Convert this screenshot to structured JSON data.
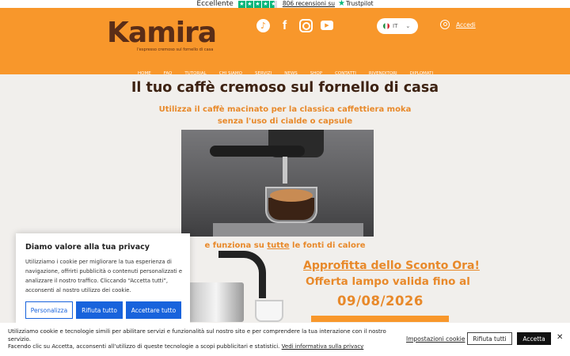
{
  "trustpilot": {
    "label": "Eccellente",
    "reviews": "806 recensioni su",
    "brand": "Trustpilot",
    "stars": 4.5
  },
  "brand": {
    "name": "Kamira",
    "tagline": "l'espresso cremoso sul fornello di casa",
    "primary_color": "#f8972b",
    "text_color": "#3d2212"
  },
  "social": [
    "tiktok-icon",
    "facebook-icon",
    "instagram-icon",
    "youtube-icon"
  ],
  "language": {
    "selected": "IT"
  },
  "login": {
    "label": "Accedi"
  },
  "nav": [
    "HOME",
    "FAQ",
    "TUTORIAL",
    "CHI SIAMO",
    "SERVIZI",
    "NEWS",
    "SHOP",
    "CONTATTI",
    "RIVENDITORI",
    "DIPLOMATI"
  ],
  "hero": {
    "title": "Il tuo caffè cremoso sul fornello di casa",
    "sub1": "Utilizza il caffè macinato per la classica caffettiera moka",
    "sub2": "senza l'uso di cialde o capsule",
    "line3_pre": "e funziona su ",
    "line3_u": "tutte",
    "line3_post": " le fonti di calore"
  },
  "promo": {
    "line1": "Approfitta dello Sconto Ora!",
    "line2": "Offerta lampo valida fino al",
    "date": "09/08/2026"
  },
  "cookie_modal": {
    "title": "Diamo valore alla tua privacy",
    "body": "Utilizziamo i cookie per migliorare la tua esperienza di navigazione, offrirti pubblicità o contenuti personalizzati e analizzare il nostro traffico. Cliccando “Accetta tutti”, acconsenti al nostro utilizzo dei cookie.",
    "customize": "Personalizza",
    "reject": "Rifiuta tutto",
    "accept": "Accettare tutto"
  },
  "cookie_bar": {
    "text1": "Utilizziamo cookie e tecnologie simili per abilitare servizi e funzionalità sul nostro sito e per comprendere la tua interazione con il nostro servizio.",
    "text2": "Facendo clic su Accetta, acconsenti all'utilizzo di queste tecnologie a scopi pubblicitari e statistici. ",
    "link": "Vedi informativa sulla privacy",
    "settings": "Impostazioni cookie",
    "reject": "Rifiuta tutti",
    "accept": "Accetta"
  }
}
